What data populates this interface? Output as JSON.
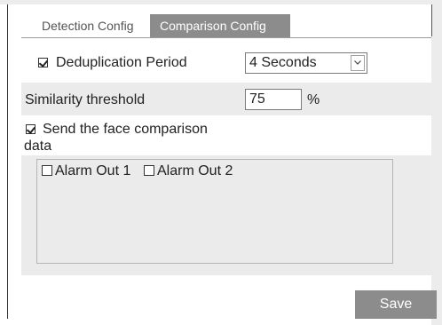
{
  "tabs": [
    {
      "label": "Detection Config",
      "active": false
    },
    {
      "label": "Comparison Config",
      "active": true
    }
  ],
  "deduplication": {
    "checked": true,
    "label": "Deduplication Period",
    "selected": "4 Seconds"
  },
  "similarity": {
    "label": "Similarity threshold",
    "value": "75",
    "unit": "%"
  },
  "send_data": {
    "checked": true,
    "label_line1": "Send the face comparison",
    "label_line2": "data"
  },
  "alarm_outputs": [
    {
      "label": "Alarm Out 1",
      "checked": false
    },
    {
      "label": "Alarm Out 2",
      "checked": false
    }
  ],
  "actions": {
    "save_label": "Save"
  },
  "colors": {
    "tab_active_bg": "#8c8c8c",
    "button_bg": "#8c8c8c",
    "row_band": "#ebebeb"
  }
}
